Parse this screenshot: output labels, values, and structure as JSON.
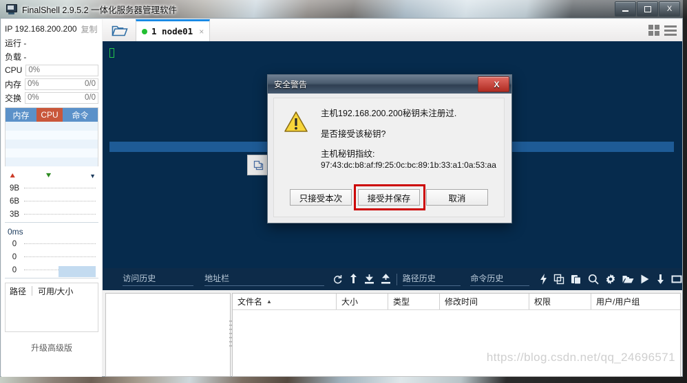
{
  "window": {
    "title": "FinalShell 2.9.5.2 一体化服务器管理软件",
    "app_icon": "monitor-icon",
    "minimize_label": "—",
    "maximize_label": "□",
    "close_label": "X"
  },
  "sidebar": {
    "ip_label": "IP 192.168.200.200",
    "copy_label": "复制",
    "uptime_label": "运行 -",
    "load_label": "负载 -",
    "metrics": [
      {
        "name": "CPU",
        "value": "0%",
        "right": ""
      },
      {
        "name": "内存",
        "value": "0%",
        "right": "0/0"
      },
      {
        "name": "交换",
        "value": "0%",
        "right": "0/0"
      }
    ],
    "process_table": {
      "columns": [
        "内存",
        "CPU",
        "命令"
      ],
      "rows": []
    },
    "net_graph": {
      "up_icon": "arrow-up-icon",
      "down_icon": "arrow-down-icon",
      "caret_icon": "chevron-down-icon",
      "ticks": [
        "9B",
        "6B",
        "3B"
      ]
    },
    "latency_graph": {
      "unit_label": "0ms",
      "ticks": [
        "0",
        "0",
        "0"
      ]
    },
    "disk_table": {
      "columns": [
        "路径",
        "可用/大小"
      ],
      "rows": []
    },
    "upgrade_label": "升级高级版"
  },
  "tabbar": {
    "folder_icon": "open-folder-icon",
    "tabs": [
      {
        "status": "connected",
        "label": "1 node01",
        "close_label": "×"
      }
    ],
    "grid_view_icon": "grid-view-icon",
    "list_view_icon": "list-view-icon"
  },
  "terminal": {
    "cursor": "block-cursor",
    "copy_icon": "copy-icon"
  },
  "toolbar": {
    "visit_history_placeholder": "访问历史",
    "address_bar_placeholder": "地址栏",
    "path_history_placeholder": "路径历史",
    "command_history_placeholder": "命令历史",
    "icons_left": [
      "refresh-icon",
      "upload-arrow-icon",
      "download-icon",
      "upload-icon"
    ],
    "icons_right": [
      "lightning-icon",
      "copy-icon",
      "paste-icon",
      "search-icon",
      "gear-icon",
      "folder-open-icon",
      "play-icon",
      "download-arrow-icon",
      "window-icon"
    ]
  },
  "file_list": {
    "columns": [
      {
        "label": "文件名",
        "sort": "▲"
      },
      {
        "label": "大小",
        "sort": ""
      },
      {
        "label": "类型",
        "sort": ""
      },
      {
        "label": "修改时间",
        "sort": ""
      },
      {
        "label": "权限",
        "sort": ""
      },
      {
        "label": "用户/用户组",
        "sort": ""
      }
    ],
    "rows": []
  },
  "watermark": "https://blog.csdn.net/qq_24696571",
  "dialog": {
    "title": "安全警告",
    "close_label": "X",
    "icon": "warning-triangle-icon",
    "line1": "主机192.168.200.200秘钥未注册过.",
    "line2": "是否接受该秘钥?",
    "line3": "主机秘钥指纹:",
    "fingerprint": "97:43:dc:b8:af:f9:25:0c:bc:89:1b:33:a1:0a:53:aa",
    "buttons": [
      {
        "label": "只接受本次",
        "highlighted": false
      },
      {
        "label": "接受并保存",
        "highlighted": true
      },
      {
        "label": "取消",
        "highlighted": false
      }
    ],
    "highlight_color": "#cc0000"
  }
}
